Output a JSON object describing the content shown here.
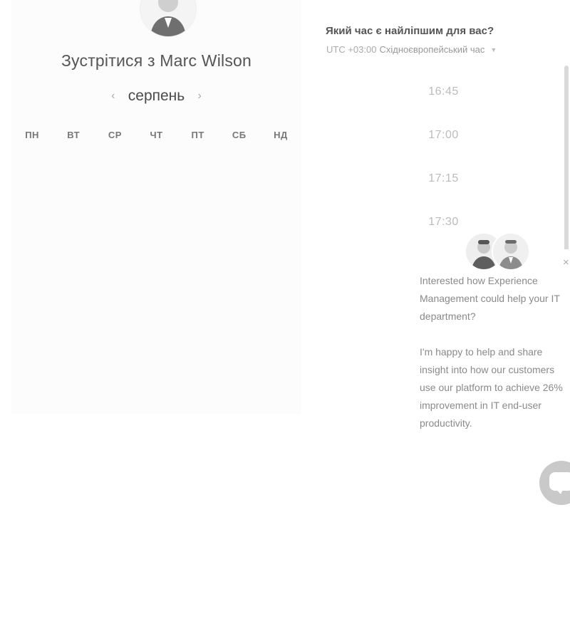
{
  "calendar": {
    "title": "Зустрітися з Marc Wilson",
    "month": "серпень",
    "weekdays": [
      "ПН",
      "ВТ",
      "СР",
      "ЧТ",
      "ПТ",
      "СБ",
      "НД"
    ],
    "days": [
      "",
      "",
      "",
      "",
      "",
      "",
      "",
      "",
      "",
      "",
      "",
      "",
      "",
      "",
      "",
      "",
      "",
      "",
      "",
      "",
      "",
      "",
      "",
      "",
      "",
      "",
      "",
      "",
      "",
      "",
      "",
      "",
      "",
      "",
      ""
    ]
  },
  "timepicker": {
    "heading": "Який час є найліпшим для вас?",
    "timezone_offset": "UTC +03:00",
    "timezone_name": "Східноєвропейський час",
    "slots": [
      "16:45",
      "17:00",
      "17:15",
      "17:30"
    ]
  },
  "chat": {
    "message_1": "Interested how Experience Management could help your IT department?",
    "message_2": "I'm happy to help and share insight into how our customers use our platform to achieve 26% improvement in IT end-user productivity."
  },
  "icons": {
    "prev": "chevron-left-icon",
    "next": "chevron-right-icon",
    "caret": "caret-down-icon",
    "close": "close-icon",
    "chat": "chat-bubble-icon"
  }
}
